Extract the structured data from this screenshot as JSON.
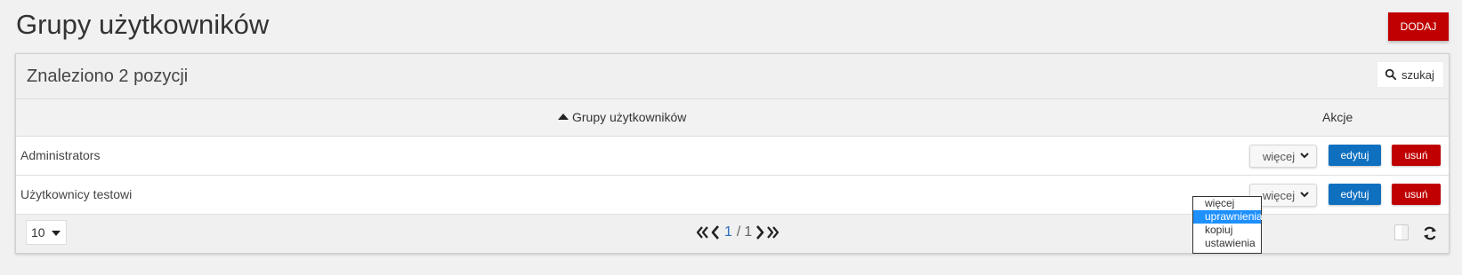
{
  "page": {
    "title": "Grupy użytkowników",
    "add_label": "DODAJ"
  },
  "list": {
    "found_text": "Znaleziono 2 pozycji",
    "search_placeholder": "szukaj",
    "columns": [
      "Grupy użytkowników",
      "Akcje"
    ],
    "rows": [
      {
        "name": "Administrators",
        "more_label": "więcej",
        "edit_label": "edytuj",
        "delete_label": "usuń"
      },
      {
        "name": "Użytkownicy testowi",
        "more_label": "więcej",
        "edit_label": "edytuj",
        "delete_label": "usuń"
      }
    ]
  },
  "dropdown": {
    "options": [
      "więcej",
      "uprawnienia",
      "kopiuj",
      "ustawienia"
    ],
    "highlighted_index": 1
  },
  "footer": {
    "page_size": "10",
    "current_page": "1",
    "page_separator": "/",
    "total_pages": "1"
  },
  "colors": {
    "primary_red": "#c00000",
    "primary_blue": "#1070c0",
    "highlight_blue": "#1e90ff"
  },
  "icons": {
    "search": "search-icon",
    "sort": "sort-ascending-icon",
    "dropdown": "chevron-down-icon",
    "first_page": "first-page-icon",
    "previous_page": "previous-page-icon",
    "next_page": "next-page-icon",
    "last_page": "last-page-icon",
    "columns": "column-toggle-icon",
    "refresh": "refresh-icon"
  }
}
